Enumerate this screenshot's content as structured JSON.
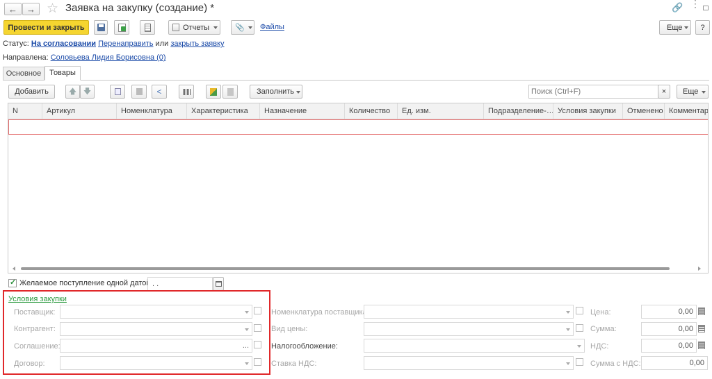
{
  "header": {
    "title": "Заявка на закупку (создание) *"
  },
  "toolbar": {
    "post_close": "Провести и закрыть",
    "reports": "Отчеты",
    "files": "Файлы",
    "more": "Еще",
    "help": "?"
  },
  "status": {
    "label": "Статус:",
    "value": "На согласовании",
    "redirect": "Перенаправить",
    "or": "или",
    "close_request": "закрыть заявку"
  },
  "assigned": {
    "label": "Направлена:",
    "value": "Соловьева Лидия Борисовна (0)"
  },
  "tabs": [
    {
      "label": "Основное",
      "active": false
    },
    {
      "label": "Товары",
      "active": true
    }
  ],
  "goods_toolbar": {
    "add": "Добавить",
    "fill": "Заполнить",
    "search_placeholder": "Поиск (Ctrl+F)",
    "clear": "×",
    "more": "Еще"
  },
  "table": {
    "columns": [
      "N",
      "Артикул",
      "Номенклатура",
      "Характеристика",
      "Назначение",
      "Количество",
      "Ед. изм.",
      "Подразделение-…",
      "Условия закупки",
      "Отменено",
      "Комментар"
    ]
  },
  "delivery": {
    "checkbox_label": "Желаемое поступление одной датой",
    "checked": true,
    "date_value": " .  ."
  },
  "conditions": {
    "title": "Условия закупки",
    "supplier": "Поставщик:",
    "counterparty": "Контрагент:",
    "agreement": "Соглашение:",
    "contract": "Договор:",
    "supplier_nomenclature": "Номенклатура поставщика:",
    "price_type": "Вид цены:",
    "taxation": "Налогообложение:",
    "vat_rate": "Ставка НДС:",
    "price": "Цена:",
    "sum": "Сумма:",
    "vat": "НДС:",
    "sum_with_vat": "Сумма с НДС:",
    "price_value": "0,00",
    "sum_value": "0,00",
    "vat_value": "0,00",
    "sum_with_vat_value": "0,00",
    "ellipsis": "..."
  },
  "colors": {
    "accent_yellow": "#f5d530",
    "highlight_red": "#e0282a",
    "link_blue": "#1a4aa8",
    "green_link": "#2a9a3e"
  }
}
